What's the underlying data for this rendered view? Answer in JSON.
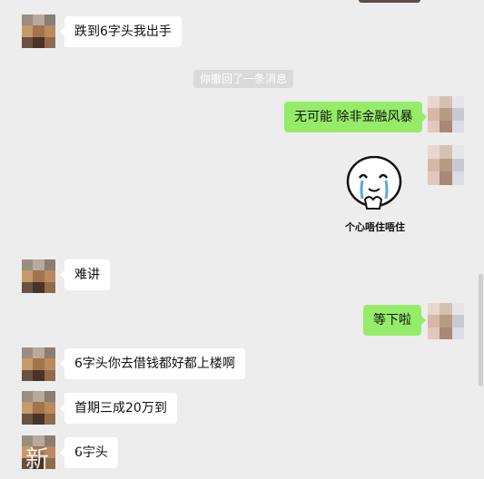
{
  "messages": [
    {
      "side": "in",
      "text": "跌到6字头我出手"
    },
    {
      "side": "out",
      "text": "无可能 除非金融风暴"
    },
    {
      "side": "in",
      "text": "难讲"
    },
    {
      "side": "out",
      "text": "等下啦"
    },
    {
      "side": "in",
      "text": "6字头你去借钱都好都上楼啊"
    },
    {
      "side": "in",
      "text": "首期三成20万到"
    },
    {
      "side": "in",
      "text": "6字头"
    }
  ],
  "system_notice": "你撤回了一条消息",
  "sticker": {
    "caption": "个心唔住唔住",
    "icon": "crying-face-sticker"
  },
  "watermark": "新 三",
  "colors": {
    "background": "#ededed",
    "outgoing_bubble": "#95ec69",
    "incoming_bubble": "#ffffff"
  }
}
